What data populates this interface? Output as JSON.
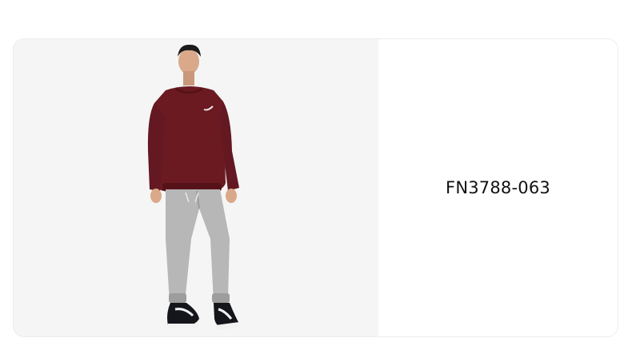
{
  "product": {
    "image": {
      "description_icon": "model-wearing-crewneck-and-joggers",
      "colors": {
        "sweatshirt": "#6b1a22",
        "sweatshirt_shadow": "#561219",
        "joggers": "#b7b7b7",
        "joggers_shadow": "#9d9d9d",
        "skin": "#d9a98a",
        "hair": "#1b1b1b",
        "shoe": "#15161c",
        "shoe_sole": "#f2f2f2",
        "background": "#f5f5f5"
      }
    },
    "sku": "FN3788-063"
  }
}
